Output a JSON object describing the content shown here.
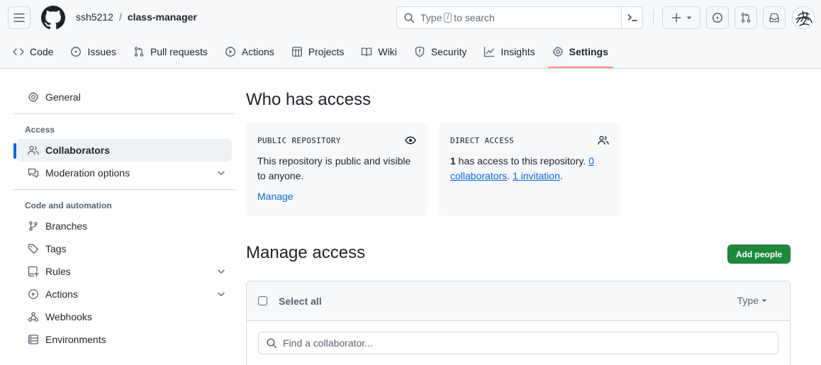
{
  "header": {
    "owner": "ssh5212",
    "separator": "/",
    "repo": "class-manager",
    "search_prefix": "Type",
    "search_key": "/",
    "search_suffix": "to search"
  },
  "repo_nav": [
    {
      "label": "Code",
      "icon": "code-icon"
    },
    {
      "label": "Issues",
      "icon": "issue-icon"
    },
    {
      "label": "Pull requests",
      "icon": "pull-request-icon"
    },
    {
      "label": "Actions",
      "icon": "play-icon"
    },
    {
      "label": "Projects",
      "icon": "table-icon"
    },
    {
      "label": "Wiki",
      "icon": "book-icon"
    },
    {
      "label": "Security",
      "icon": "shield-icon"
    },
    {
      "label": "Insights",
      "icon": "graph-icon"
    },
    {
      "label": "Settings",
      "icon": "gear-icon",
      "selected": true
    }
  ],
  "sidebar": {
    "general": "General",
    "access_heading": "Access",
    "collaborators": "Collaborators",
    "moderation": "Moderation options",
    "code_heading": "Code and automation",
    "branches": "Branches",
    "tags": "Tags",
    "rules": "Rules",
    "actions": "Actions",
    "webhooks": "Webhooks",
    "environments": "Environments"
  },
  "main": {
    "who_title": "Who has access",
    "public_card": {
      "label": "PUBLIC REPOSITORY",
      "text": "This repository is public and visible to anyone.",
      "manage": "Manage"
    },
    "direct_card": {
      "label": "DIRECT ACCESS",
      "count": "1",
      "text": " has access to this repository. ",
      "collaborators_link": "0 collaborators",
      "dot1": ". ",
      "invitation_link": "1 invitation",
      "dot2": "."
    },
    "manage_title": "Manage access",
    "add_people": "Add people",
    "select_all": "Select all",
    "type_filter": "Type",
    "find_placeholder": "Find a collaborator..."
  },
  "colors": {
    "accent": "#0969da",
    "primary_button": "#1f883d",
    "nav_underline": "#fd8c73"
  }
}
